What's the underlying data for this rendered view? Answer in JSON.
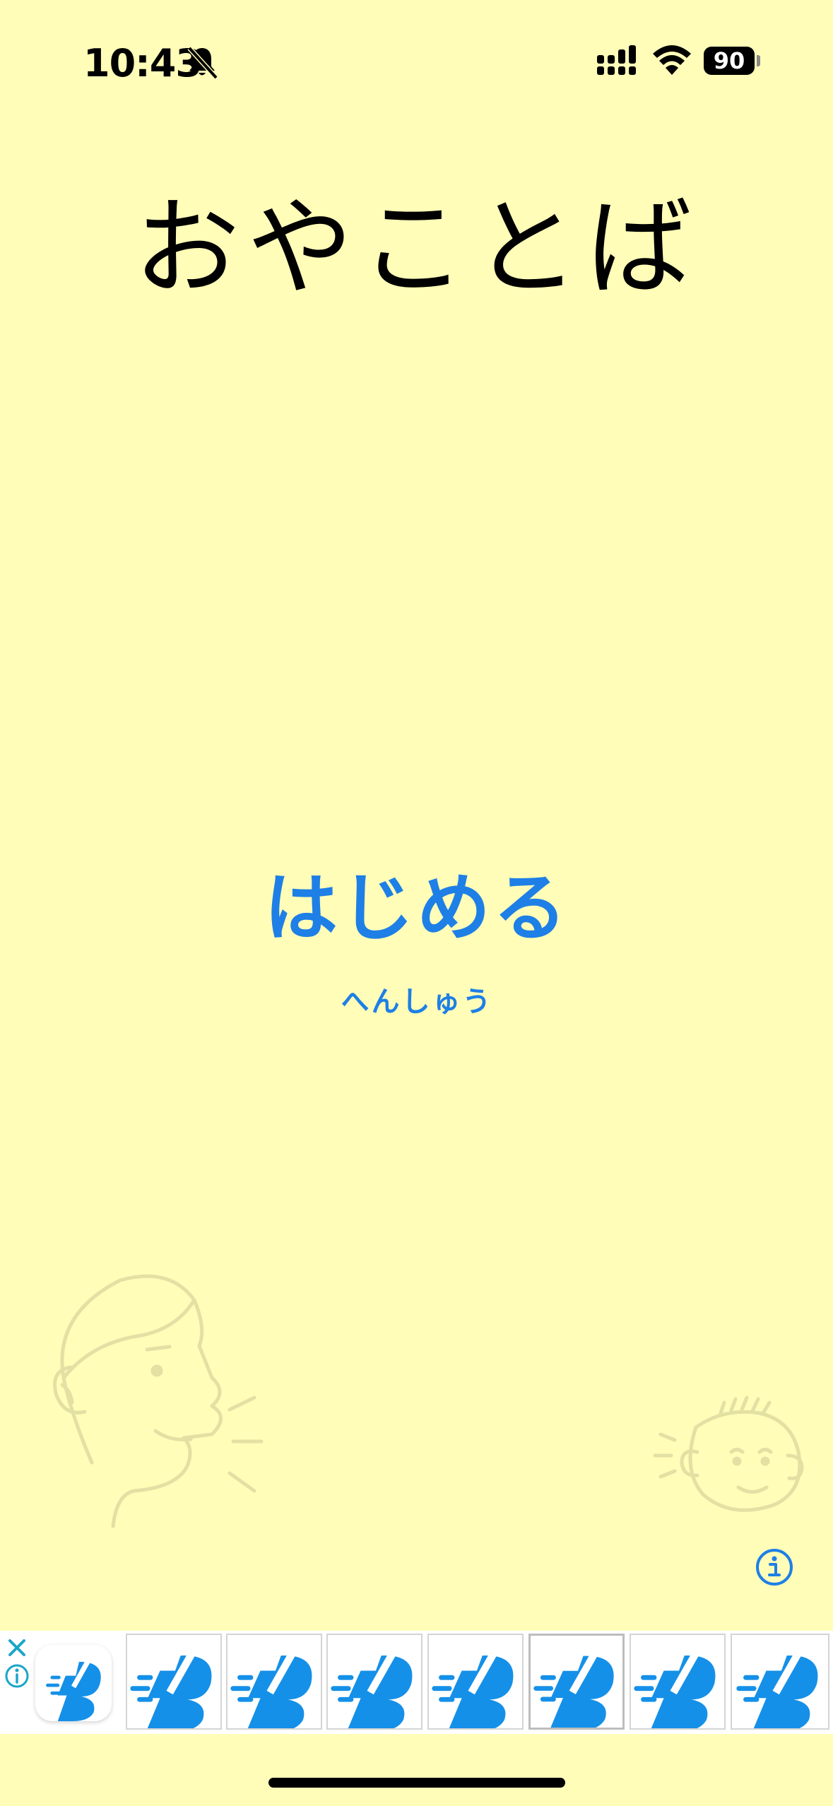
{
  "status_bar": {
    "time": "10:43",
    "battery_level": "90",
    "icons": [
      "bell-slash-icon",
      "signal-icon",
      "wifi-icon",
      "battery-icon"
    ]
  },
  "app": {
    "title": "おやことば",
    "start_label": "はじめる",
    "edit_label": "へんしゅう"
  },
  "colors": {
    "background": "#FFFDB8",
    "accent": "#1E7FE6",
    "ad_blue": "#1590E8"
  },
  "ad": {
    "icons": [
      "ad-close-icon",
      "ad-info-icon"
    ]
  }
}
